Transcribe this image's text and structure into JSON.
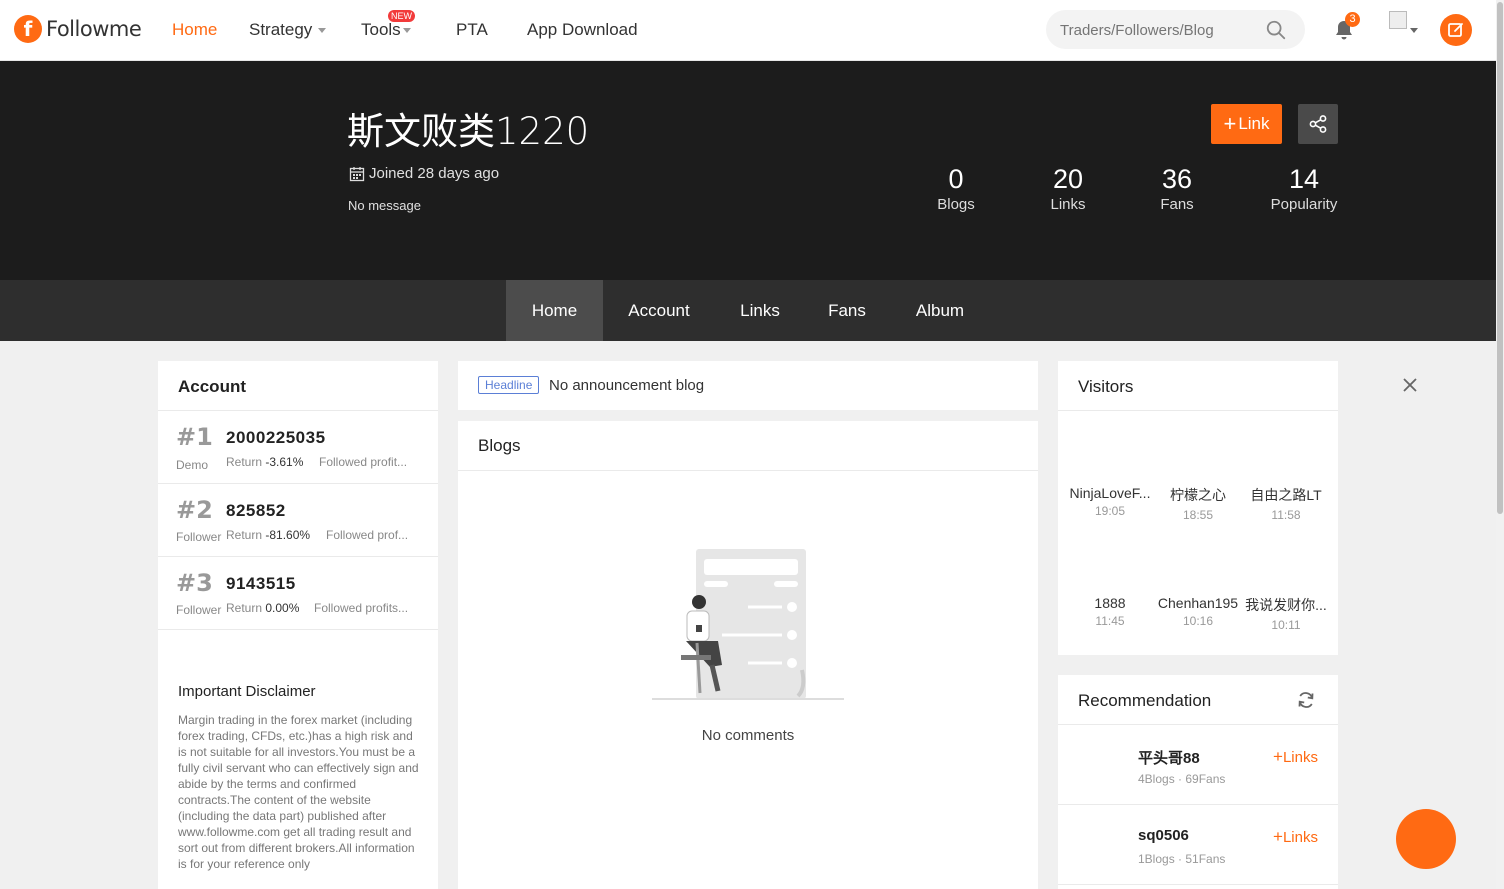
{
  "brand": {
    "name": "Followme",
    "accent": "#ff6a13"
  },
  "nav": {
    "items": [
      {
        "label": "Home",
        "active": true
      },
      {
        "label": "Strategy",
        "dropdown": true
      },
      {
        "label": "Tools",
        "dropdown": true,
        "badge": "NEW"
      },
      {
        "label": "PTA"
      },
      {
        "label": "App Download"
      }
    ],
    "search_placeholder": "Traders/Followers/Blog",
    "notification_count": "3"
  },
  "profile": {
    "username": "斯文败类1220",
    "joined": "Joined 28 days ago",
    "message": "No message",
    "link_button": "Link",
    "stats": [
      {
        "value": "0",
        "label": "Blogs"
      },
      {
        "value": "20",
        "label": "Links"
      },
      {
        "value": "36",
        "label": "Fans"
      },
      {
        "value": "14",
        "label": "Popularity"
      }
    ]
  },
  "tabs": [
    "Home",
    "Account",
    "Links",
    "Fans",
    "Album"
  ],
  "account": {
    "title": "Account",
    "rows": [
      {
        "rank": "#1",
        "number": "2000225035",
        "type": "Demo",
        "return_label": "Return",
        "return_value": "-3.61%",
        "followed": "Followed profit..."
      },
      {
        "rank": "#2",
        "number": "825852",
        "type": "Follower",
        "return_label": "Return",
        "return_value": "-81.60%",
        "followed": "Followed prof..."
      },
      {
        "rank": "#3",
        "number": "9143515",
        "type": "Follower",
        "return_label": "Return",
        "return_value": "0.00%",
        "followed": "Followed profits..."
      }
    ],
    "disclaimer_title": "Important Disclaimer",
    "disclaimer_body": "Margin trading in the forex market (including forex trading, CFDs, etc.)has a high risk and is not suitable for all investors.You must be a fully civil servant who can effectively sign and abide by the terms and confirmed contracts.The content of the website (including the data part) published after www.followme.com get all trading result and sort out from different brokers.All information is for your reference only"
  },
  "announcement": {
    "tag": "Headline",
    "text": "No announcement blog"
  },
  "blogs": {
    "title": "Blogs",
    "empty_text": "No comments"
  },
  "visitors": {
    "title": "Visitors",
    "items": [
      {
        "name": "NinjaLoveF...",
        "time": "19:05"
      },
      {
        "name": "柠檬之心",
        "time": "18:55"
      },
      {
        "name": "自由之路LT",
        "time": "11:58"
      },
      {
        "name": "1888",
        "time": "11:45"
      },
      {
        "name": "Chenhan195",
        "time": "10:16"
      },
      {
        "name": "我说发财你...",
        "time": "10:11"
      }
    ]
  },
  "recommendation": {
    "title": "Recommendation",
    "items": [
      {
        "name": "平头哥88",
        "meta": "4Blogs · 69Fans",
        "action": "Links"
      },
      {
        "name": "sq0506",
        "meta": "1Blogs · 51Fans",
        "action": "Links"
      }
    ]
  }
}
